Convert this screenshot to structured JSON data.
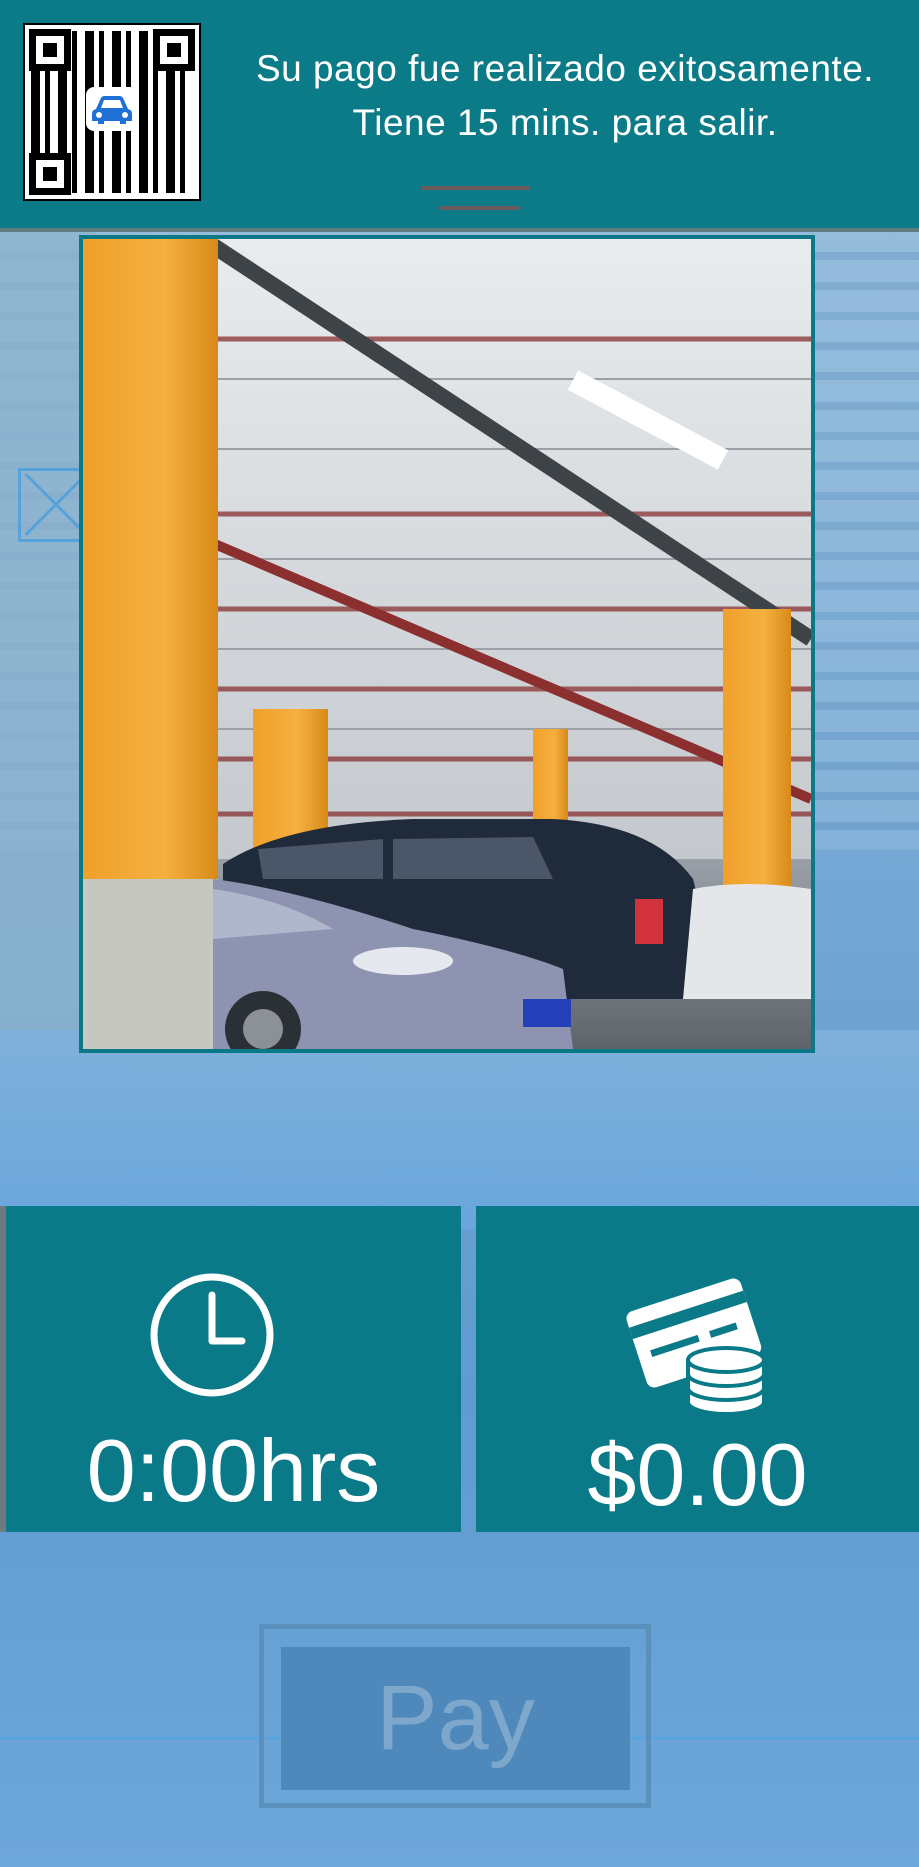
{
  "header": {
    "message_line1": "Su pago fue realizado exitosamente.",
    "message_line2": "Tiene 15 mins. para salir."
  },
  "stats": {
    "time_value": "0:00hrs",
    "cost_value": "$0.00"
  },
  "pay_button": {
    "label": "Pay"
  },
  "icons": {
    "qr": "qr-code-icon",
    "car": "car-icon",
    "clock": "clock-icon",
    "payment": "credit-card-coins-icon"
  },
  "colors": {
    "header_bg": "#0c7b88",
    "tile_bg": "#0b7a88",
    "frame": "#0a7886",
    "text": "#ffffff",
    "pay_button_bg": "#4f89bb",
    "pay_button_text": "#7ea7cc"
  }
}
